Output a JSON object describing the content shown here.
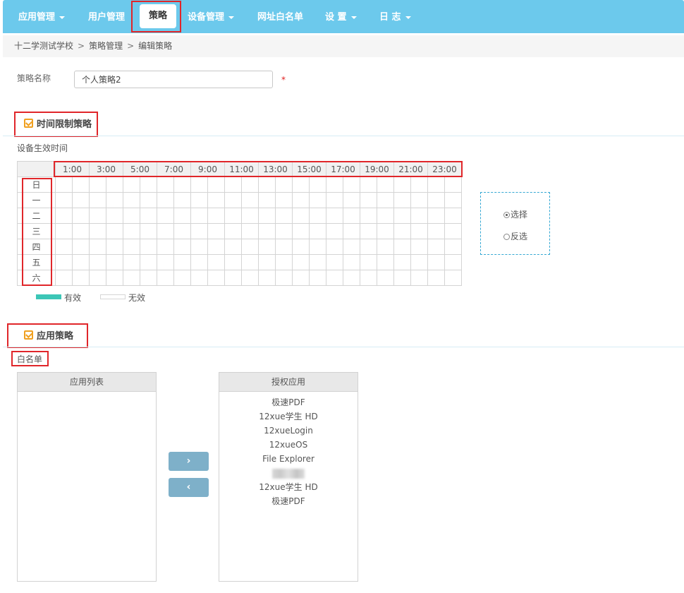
{
  "nav": {
    "items": [
      {
        "label": "应用管理",
        "has_caret": true
      },
      {
        "label": "用户管理",
        "has_caret": false
      },
      {
        "label": "策略",
        "has_caret": false,
        "active": true
      },
      {
        "label": "设备管理",
        "has_caret": true
      },
      {
        "label": "网址白名单",
        "has_caret": false
      },
      {
        "label": "设 置",
        "has_caret": true
      },
      {
        "label": "日 志",
        "has_caret": true
      }
    ],
    "bg_color": "#6cc9ec"
  },
  "breadcrumb": {
    "items": [
      "十二学测试学校",
      "策略管理",
      "编辑策略"
    ],
    "separator": ">"
  },
  "form": {
    "name_label": "策略名称",
    "name_value": "个人策略2",
    "required_mark": "*"
  },
  "time_section": {
    "title": "时间限制策略",
    "checked": true,
    "effective_label": "设备生效时间",
    "hours": [
      "1:00",
      "3:00",
      "5:00",
      "7:00",
      "9:00",
      "11:00",
      "13:00",
      "15:00",
      "17:00",
      "19:00",
      "21:00",
      "23:00"
    ],
    "days": [
      "日",
      "一",
      "二",
      "三",
      "四",
      "五",
      "六"
    ],
    "legend": {
      "valid": "有效",
      "invalid": "无效",
      "valid_color": "#3cc6b6"
    },
    "options": [
      {
        "label": "选择",
        "selected": true
      },
      {
        "label": "反选",
        "selected": false
      }
    ]
  },
  "app_section": {
    "title": "应用策略",
    "checked": true,
    "whitelist_label": "白名单",
    "app_list_header": "应用列表",
    "app_list": [],
    "authorized_header": "授权应用",
    "authorized_apps": [
      "极速PDF",
      "12xue学生 HD",
      "12xueLogin",
      "12xueOS",
      "File Explorer",
      "",
      "12xue学生 HD",
      "极速PDF"
    ],
    "move_right_icon": "chevron-right-icon",
    "move_left_icon": "chevron-left-icon"
  },
  "highlight_color": "#e0262a"
}
